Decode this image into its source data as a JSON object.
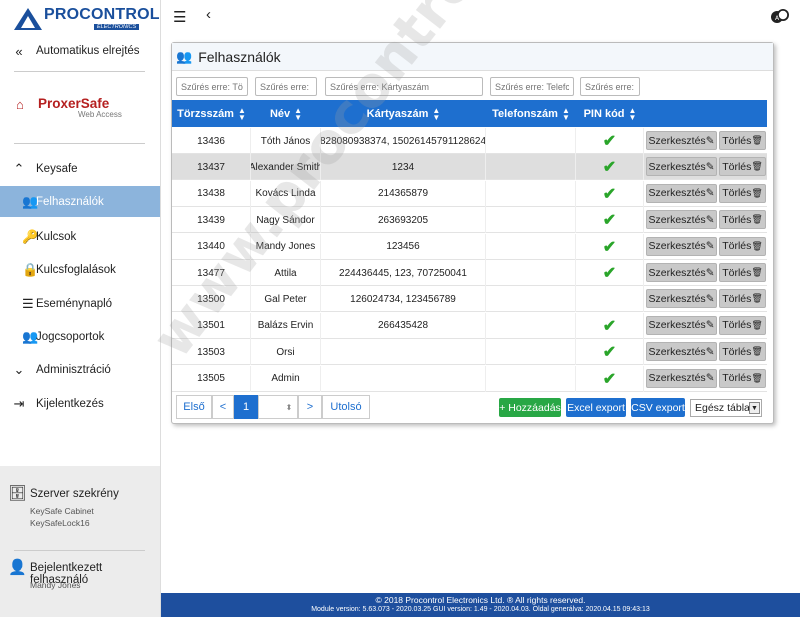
{
  "brand": {
    "name": "PROCONTROL",
    "sub": "ELECTRONICS"
  },
  "sidebar": {
    "auto_hide": "Automatikus elrejtés",
    "proxer_name": "ProxerSafe",
    "proxer_sub": "Web Access",
    "keysafe": "Keysafe",
    "items": [
      {
        "label": "Felhasználók",
        "icon": "users-cog-icon"
      },
      {
        "label": "Kulcsok",
        "icon": "keys-icon"
      },
      {
        "label": "Kulcsfoglalások",
        "icon": "lock-icon"
      },
      {
        "label": "Eseménynapló",
        "icon": "list-icon"
      },
      {
        "label": "Jogcsoportok",
        "icon": "group-icon"
      }
    ],
    "admin": "Adminisztráció",
    "logout": "Kijelentkezés",
    "server_title": "Szerver szekrény",
    "server_lines": [
      "KeySafe Cabinet",
      "KeySafeLock16"
    ],
    "user_title": "Bejelentkezett felhasználó",
    "user_name": "Mandy Jones"
  },
  "panel": {
    "title": "Felhasználók",
    "filters": [
      "Szűrés erre: Tö",
      "Szűrés erre: I",
      "Szűrés erre: Kártyaszám",
      "Szűrés erre: Telefc",
      "Szűrés erre:"
    ],
    "columns": [
      "Törzsszám",
      "Név",
      "Kártyaszám",
      "Telefonszám",
      "PIN kód"
    ],
    "edit_label": "Szerkesztés",
    "delete_label": "Törlés",
    "rows": [
      {
        "id": "13436",
        "name": "Tóth János",
        "card": "828080938374, 15026145791128624",
        "phone": "",
        "pin": true
      },
      {
        "id": "13437",
        "name": "Alexander Smith",
        "card": "1234",
        "phone": "",
        "pin": true
      },
      {
        "id": "13438",
        "name": "Kovács Linda",
        "card": "214365879",
        "phone": "",
        "pin": true
      },
      {
        "id": "13439",
        "name": "Nagy Sándor",
        "card": "263693205",
        "phone": "",
        "pin": true
      },
      {
        "id": "13440",
        "name": "Mandy Jones",
        "card": "123456",
        "phone": "",
        "pin": true
      },
      {
        "id": "13477",
        "name": "Attila",
        "card": "224436445, 123, 707250041",
        "phone": "",
        "pin": true
      },
      {
        "id": "13500",
        "name": "Gal Peter",
        "card": "126024734, 123456789",
        "phone": "",
        "pin": false
      },
      {
        "id": "13501",
        "name": "Balázs Ervin",
        "card": "266435428",
        "phone": "",
        "pin": true
      },
      {
        "id": "13503",
        "name": "Orsi",
        "card": "",
        "phone": "",
        "pin": true
      },
      {
        "id": "13505",
        "name": "Admin",
        "card": "",
        "phone": "",
        "pin": true
      }
    ],
    "pager": {
      "first": "Első",
      "prev": "<",
      "current": "1",
      "next": ">",
      "last": "Utolsó"
    },
    "add_label": "+ Hozzáadás",
    "excel_label": "Excel export",
    "csv_label": "CSV export",
    "scope_label": "Egész tábla"
  },
  "footer": {
    "line1": "© 2018 Procontrol Electronics Ltd. ® All rights reserved.",
    "line2": "Module version: 5.63.073 - 2020.03.25     GUI version: 1.49 - 2020.04.03.     Oldal generálva: 2020.04.15 09:43:13"
  },
  "watermark": "www.procontrol.hu",
  "colors": {
    "header_blue": "#1e6fcf",
    "brand_blue": "#1a4f9c",
    "active": "#8cb4dc",
    "green": "#28a745",
    "check": "#2aa52a"
  }
}
